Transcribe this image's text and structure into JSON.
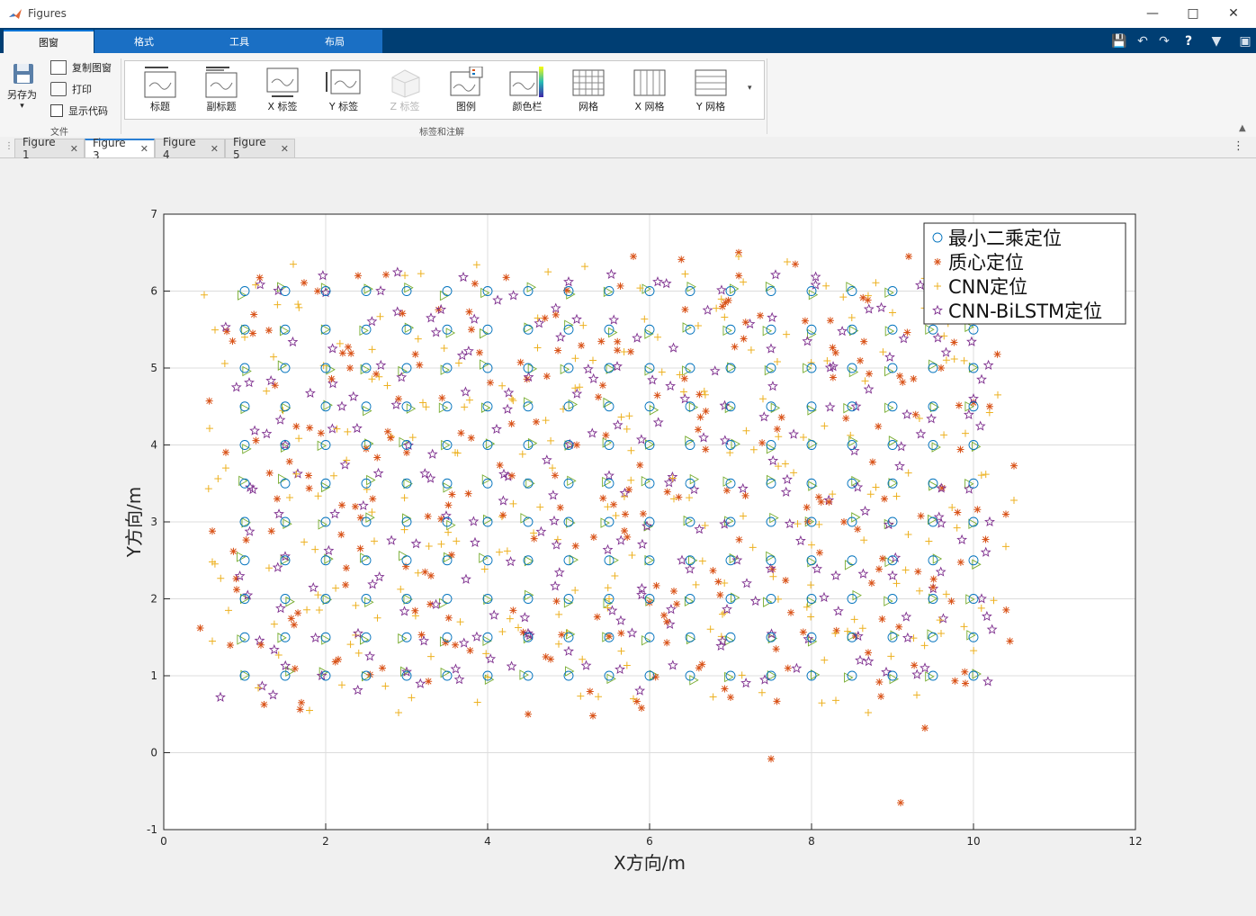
{
  "window": {
    "title": "Figures"
  },
  "ribbon": {
    "tabs": [
      "图窗",
      "格式",
      "工具",
      "布局"
    ],
    "file_group": {
      "saveas": "另存为",
      "copy": "复制图窗",
      "print": "打印",
      "showcode": "显示代码",
      "label": "文件"
    },
    "annot_group": {
      "label": "标签和注解",
      "items": [
        "标题",
        "副标题",
        "X 标签",
        "Y 标签",
        "Z 标签",
        "图例",
        "颜色栏",
        "网格",
        "X 网格",
        "Y 网格"
      ]
    }
  },
  "doc_tabs": [
    "Figure 1",
    "Figure 3",
    "Figure 4",
    "Figure 5"
  ],
  "colors": {
    "ls": "#0072bd",
    "centroid": "#d95319",
    "cnn": "#edb120",
    "cnn_bilstm": "#7e2f8e",
    "real": "#77ac30"
  },
  "chart_data": {
    "type": "scatter",
    "xlabel": "X方向/m",
    "ylabel": "Y方向/m",
    "xlim": [
      0,
      12
    ],
    "ylim": [
      -1,
      7
    ],
    "xticks": [
      "0",
      "2",
      "4",
      "6",
      "8",
      "10",
      "12"
    ],
    "yticks": [
      "-1",
      "0",
      "1",
      "2",
      "3",
      "4",
      "5",
      "6",
      "7"
    ],
    "grid": true,
    "legend_position": "top-right",
    "legend": [
      "最小二乘定位",
      "质心定位",
      "CNN定位",
      "CNN-BiLSTM定位"
    ],
    "series": [
      {
        "name": "最小二乘定位",
        "marker": "circle",
        "grid_x": [
          1,
          10,
          0.5
        ],
        "grid_y": [
          1,
          6,
          0.5
        ],
        "note": "test points on regular 0.5 m grid, x=1..10, y=1..6"
      },
      {
        "name": "质心定位",
        "marker": "asterisk",
        "points": [
          [
            0.45,
            1.62
          ],
          [
            0.6,
            2.88
          ],
          [
            0.85,
            5.35
          ],
          [
            1.1,
            5.45
          ],
          [
            0.9,
            2.12
          ],
          [
            1.2,
            1.4
          ],
          [
            1.4,
            3.3
          ],
          [
            1.7,
            0.65
          ],
          [
            1.9,
            6.0
          ],
          [
            2.4,
            6.2
          ],
          [
            2.3,
            5.0
          ],
          [
            2.5,
            3.95
          ],
          [
            2.9,
            4.6
          ],
          [
            3.3,
            2.3
          ],
          [
            3.0,
            3.9
          ],
          [
            3.6,
            1.4
          ],
          [
            3.8,
            5.5
          ],
          [
            4.3,
            3.6
          ],
          [
            4.5,
            0.5
          ],
          [
            4.6,
            4.3
          ],
          [
            5.1,
            4.0
          ],
          [
            5.3,
            0.48
          ],
          [
            5.7,
            3.1
          ],
          [
            5.8,
            6.45
          ],
          [
            5.9,
            0.58
          ],
          [
            6.3,
            2.1
          ],
          [
            6.6,
            4.2
          ],
          [
            6.9,
            5.8
          ],
          [
            7.0,
            0.72
          ],
          [
            7.1,
            6.5
          ],
          [
            7.5,
            -0.08
          ],
          [
            7.8,
            6.35
          ],
          [
            8.1,
            2.6
          ],
          [
            8.4,
            3.0
          ],
          [
            8.9,
            3.3
          ],
          [
            9.1,
            -0.65
          ],
          [
            9.2,
            6.45
          ],
          [
            9.4,
            0.32
          ],
          [
            9.6,
            5.0
          ],
          [
            9.9,
            0.9
          ],
          [
            10.0,
            4.55
          ],
          [
            10.2,
            4.5
          ],
          [
            10.5,
            3.73
          ],
          [
            10.45,
            1.45
          ],
          [
            10.4,
            3.1
          ],
          [
            9.5,
            2.15
          ],
          [
            6.0,
            1.95
          ],
          [
            3.9,
            5.2
          ],
          [
            2.7,
            1.1
          ],
          [
            8.7,
            1.3
          ]
        ]
      },
      {
        "name": "CNN定位",
        "marker": "plus",
        "points": [
          [
            0.5,
            5.95
          ],
          [
            0.6,
            2.48
          ],
          [
            0.6,
            1.45
          ],
          [
            0.8,
            1.85
          ],
          [
            1.0,
            5.4
          ],
          [
            1.3,
            2.4
          ],
          [
            1.6,
            6.35
          ],
          [
            1.8,
            0.55
          ],
          [
            2.2,
            0.88
          ],
          [
            2.6,
            2.75
          ],
          [
            2.9,
            0.52
          ],
          [
            3.2,
            4.55
          ],
          [
            3.6,
            3.9
          ],
          [
            4.0,
            0.98
          ],
          [
            4.3,
            4.6
          ],
          [
            5.2,
            6.32
          ],
          [
            5.5,
            2.0
          ],
          [
            5.8,
            0.7
          ],
          [
            6.1,
            5.4
          ],
          [
            6.3,
            3.3
          ],
          [
            6.6,
            5.55
          ],
          [
            7.1,
            6.45
          ],
          [
            7.4,
            4.6
          ],
          [
            7.7,
            6.38
          ],
          [
            8.0,
            2.7
          ],
          [
            8.3,
            0.68
          ],
          [
            8.7,
            0.52
          ],
          [
            9.0,
            5.72
          ],
          [
            9.3,
            0.75
          ],
          [
            9.6,
            1.55
          ],
          [
            9.9,
            4.15
          ],
          [
            10.3,
            4.65
          ],
          [
            10.5,
            3.28
          ],
          [
            10.4,
            2.68
          ],
          [
            10.25,
            1.98
          ],
          [
            9.05,
            2.2
          ],
          [
            6.9,
            1.8
          ],
          [
            4.8,
            3.7
          ],
          [
            3.3,
            1.25
          ],
          [
            2.1,
            3.6
          ],
          [
            7.9,
            4.1
          ],
          [
            5.3,
            5.1
          ]
        ]
      },
      {
        "name": "CNN-BiLSTM定位",
        "marker": "pentagram",
        "points": [
          [
            0.7,
            0.72
          ],
          [
            1.1,
            3.42
          ],
          [
            1.35,
            0.75
          ],
          [
            1.5,
            4.0
          ],
          [
            2.0,
            5.98
          ],
          [
            2.4,
            1.55
          ],
          [
            3.0,
            1.05
          ],
          [
            3.7,
            6.18
          ],
          [
            3.65,
            0.95
          ],
          [
            4.2,
            3.62
          ],
          [
            4.5,
            1.55
          ],
          [
            4.9,
            5.4
          ],
          [
            5.0,
            6.12
          ],
          [
            5.5,
            3.6
          ],
          [
            5.6,
            5.02
          ],
          [
            6.1,
            6.12
          ],
          [
            6.4,
            2.5
          ],
          [
            6.9,
            1.45
          ],
          [
            7.2,
            2.2
          ],
          [
            7.7,
            3.55
          ],
          [
            8.05,
            6.08
          ],
          [
            8.3,
            2.3
          ],
          [
            8.6,
            1.2
          ],
          [
            9.0,
            2.3
          ],
          [
            9.4,
            1.1
          ],
          [
            9.6,
            2.98
          ],
          [
            10.0,
            4.6
          ],
          [
            10.1,
            4.85
          ],
          [
            10.2,
            3.0
          ],
          [
            10.1,
            2.0
          ],
          [
            8.55,
            4.5
          ],
          [
            3.3,
            5.65
          ],
          [
            1.5,
            2.55
          ],
          [
            5.9,
            2.05
          ],
          [
            7.5,
            5.25
          ],
          [
            2.2,
            4.5
          ],
          [
            4.85,
            2.7
          ],
          [
            6.55,
            3.42
          ]
        ]
      },
      {
        "name": "",
        "marker": "triangle-right",
        "note": "unnamed series (not in legend), drawn near grid points",
        "grid_x": [
          1,
          10,
          0.5
        ],
        "grid_y": [
          1,
          6,
          0.5
        ]
      }
    ]
  }
}
